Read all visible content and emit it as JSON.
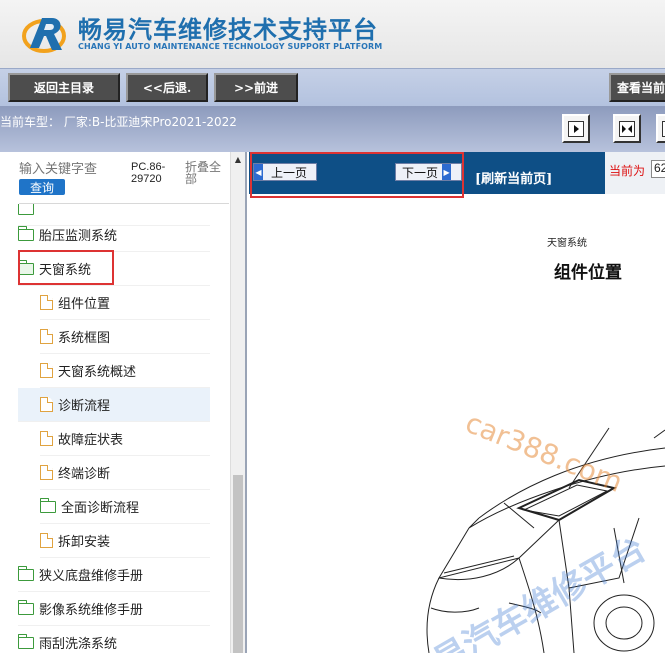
{
  "header": {
    "title": "畅易汽车维修技术支持平台",
    "subtitle": "CHANG YI AUTO MAINTENANCE TECHNOLOGY SUPPORT PLATFORM"
  },
  "nav": {
    "home": "返回主目录",
    "back": "<<后退.",
    "forward": ">>前进",
    "current": "查看当前"
  },
  "model_bar": {
    "text": "当前车型： 厂家:B-比亚迪宋Pro2021-2022"
  },
  "sidebar": {
    "search_placeholder": "输入关键字查",
    "search_button": "查询",
    "pc_code_line1": "PC.86-",
    "pc_code_line2": "29720",
    "collapse_all": "折叠全部",
    "items": [
      {
        "label": "胎压监测系统",
        "type": "folder"
      },
      {
        "label": "天窗系统",
        "type": "folder-open"
      },
      {
        "label": "组件位置",
        "type": "file"
      },
      {
        "label": "系统框图",
        "type": "file"
      },
      {
        "label": "天窗系统概述",
        "type": "file"
      },
      {
        "label": "诊断流程",
        "type": "file"
      },
      {
        "label": "故障症状表",
        "type": "file"
      },
      {
        "label": "终端诊断",
        "type": "file"
      },
      {
        "label": "全面诊断流程",
        "type": "folder"
      },
      {
        "label": "拆卸安装",
        "type": "file"
      },
      {
        "label": "狭义底盘维修手册",
        "type": "folder"
      },
      {
        "label": "影像系统维修手册",
        "type": "folder"
      },
      {
        "label": "雨刮洗涤系统",
        "type": "folder"
      }
    ]
  },
  "pager": {
    "prev": "上一页",
    "next": "下一页",
    "refresh": "[刷新当前页]",
    "current_label": "当前为",
    "current_page": "62"
  },
  "document": {
    "header": "天窗系统",
    "title": "组件位置",
    "watermark_1": "car388.com",
    "watermark_2": "易汽车维修平台"
  }
}
